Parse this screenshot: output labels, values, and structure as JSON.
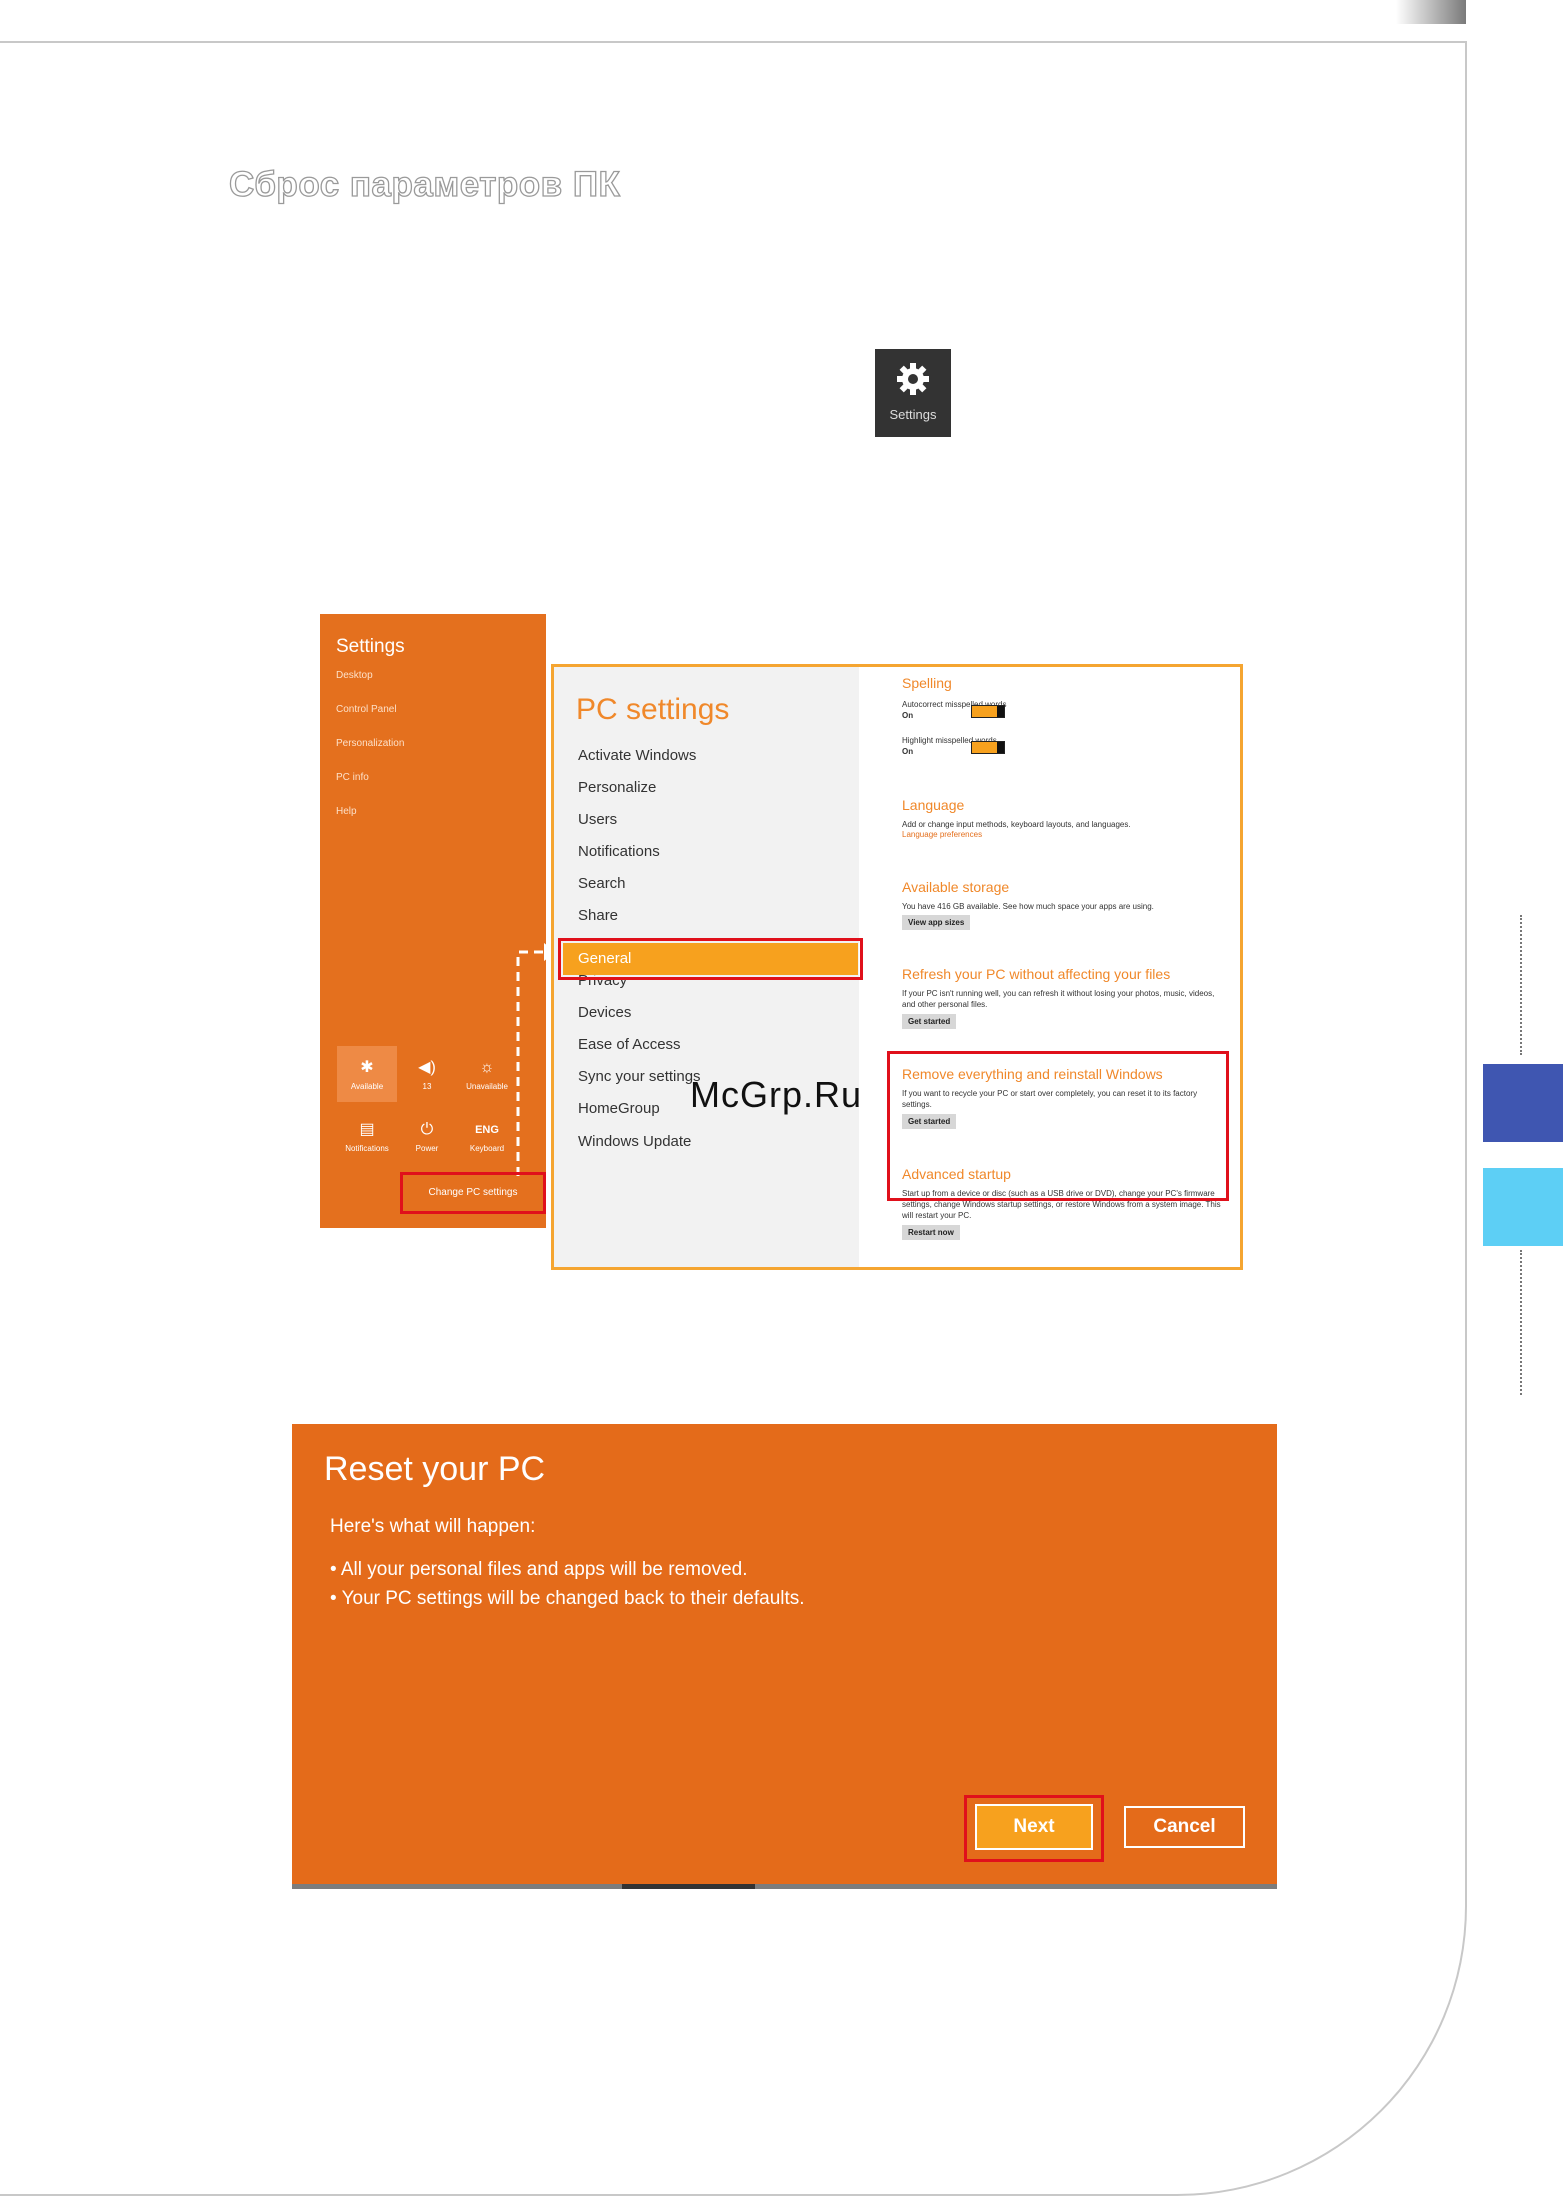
{
  "page": {
    "title": "Сброс параметров ПК",
    "watermark": "McGrp.Ru"
  },
  "settings_tile": {
    "label": "Settings",
    "icon": "gear-icon"
  },
  "charms": {
    "title": "Settings",
    "items": [
      "Desktop",
      "Control Panel",
      "Personalization",
      "PC info",
      "Help"
    ],
    "quick": [
      {
        "icon": "wifi-icon",
        "label": "Available"
      },
      {
        "icon": "volume-icon",
        "label": "13"
      },
      {
        "icon": "brightness-icon",
        "label": "Unavailable"
      },
      {
        "icon": "notifications-icon",
        "label": "Notifications"
      },
      {
        "icon": "power-icon",
        "label": "Power"
      },
      {
        "icon": "keyboard-icon",
        "glyph": "ENG",
        "label": "Keyboard"
      }
    ],
    "change_pc_settings": "Change PC settings"
  },
  "pc_settings": {
    "title": "PC settings",
    "nav": [
      "Activate Windows",
      "Personalize",
      "Users",
      "Notifications",
      "Search",
      "Share",
      "General",
      "Privacy",
      "Devices",
      "Ease of Access",
      "Sync your settings",
      "HomeGroup",
      "Windows Update"
    ],
    "selected": "General",
    "spelling": {
      "heading": "Spelling",
      "autocorrect_label": "Autocorrect misspelled words",
      "autocorrect_state": "On",
      "highlight_label": "Highlight misspelled words",
      "highlight_state": "On"
    },
    "language": {
      "heading": "Language",
      "text": "Add or change input methods, keyboard layouts, and languages.",
      "link": "Language preferences"
    },
    "storage": {
      "heading": "Available storage",
      "text": "You have 416 GB available. See how much space your apps are using.",
      "button": "View app sizes"
    },
    "refresh": {
      "heading": "Refresh your PC without affecting your files",
      "text": "If your PC isn't running well, you can refresh it without losing your photos, music, videos, and other personal files.",
      "button": "Get started"
    },
    "remove": {
      "heading": "Remove everything and reinstall Windows",
      "text": "If you want to recycle your PC or start over completely, you can reset it to its factory settings.",
      "button": "Get started"
    },
    "advanced": {
      "heading": "Advanced startup",
      "text": "Start up from a device or disc (such as a USB drive or DVD), change your PC's firmware settings, change Windows startup settings, or restore Windows from a system image. This will restart your PC.",
      "button": "Restart now"
    }
  },
  "reset_dialog": {
    "title": "Reset your PC",
    "subtitle": "Here's what will happen:",
    "bullets": [
      "• All your personal files and apps will be removed.",
      "• Your PC settings will be changed back to their defaults."
    ],
    "next": "Next",
    "cancel": "Cancel"
  },
  "colors": {
    "accent": "#e46b1a",
    "highlight": "#f7a11e",
    "callout": "#e0101b",
    "tab_blue": "#3f56b1",
    "tab_cyan": "#5dcff5"
  }
}
